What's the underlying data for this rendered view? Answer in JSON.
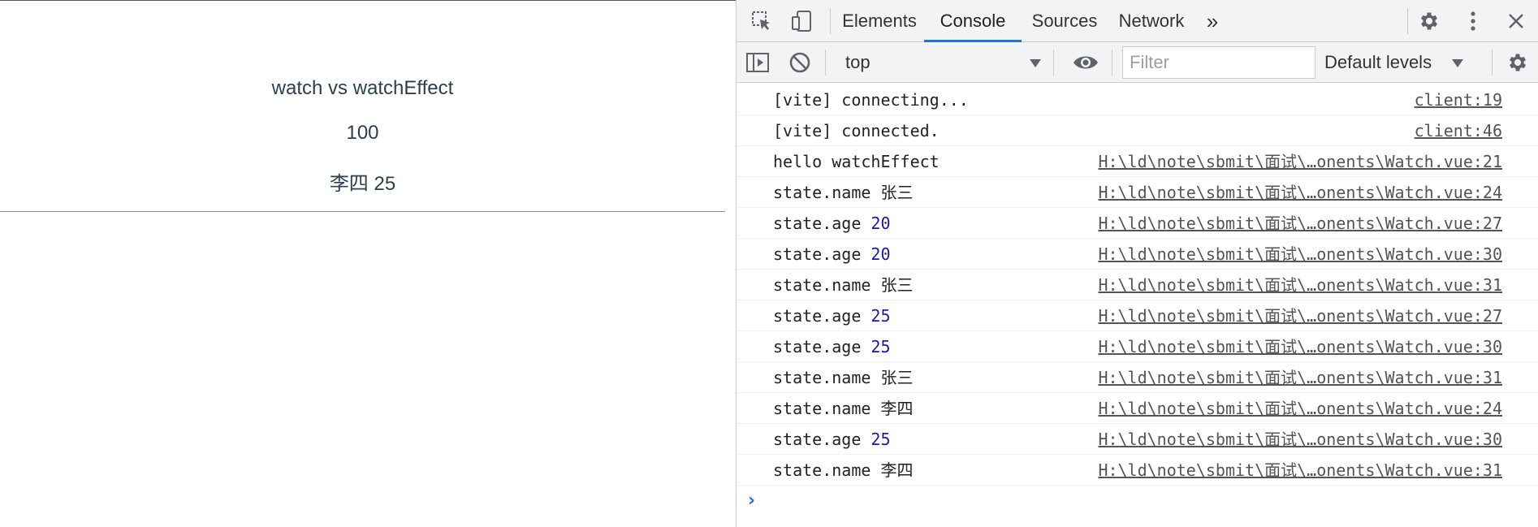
{
  "page": {
    "title": "watch vs watchEffect",
    "count": "100",
    "person": "李四 25"
  },
  "devtools": {
    "tabs": [
      {
        "label": "Elements",
        "active": false
      },
      {
        "label": "Console",
        "active": true
      },
      {
        "label": "Sources",
        "active": false
      },
      {
        "label": "Network",
        "active": false
      }
    ],
    "more_tabs_glyph": "»",
    "icons": {
      "inspect": "inspect-element-icon",
      "device": "device-toolbar-icon",
      "settings": "gear-icon",
      "menu": "kebab-menu-icon",
      "close": "close-icon",
      "sidebar": "console-sidebar-icon",
      "clear": "clear-console-icon",
      "eye": "live-expression-eye-icon",
      "console_settings": "console-settings-gear-icon"
    },
    "console_toolbar": {
      "context": "top",
      "filter_placeholder": "Filter",
      "filter_value": "",
      "levels": "Default levels"
    },
    "accent_color": "#1a73e8",
    "number_color": "#1a1aa6",
    "messages": [
      {
        "text": "[vite] connecting...",
        "label": "",
        "value": "",
        "source": "client:19"
      },
      {
        "text": "[vite] connected.",
        "label": "",
        "value": "",
        "source": "client:46"
      },
      {
        "text": "hello watchEffect",
        "label": "",
        "value": "",
        "source": "H:\\ld\\note\\sbmit\\面试\\…onents\\Watch.vue:21"
      },
      {
        "text": "",
        "label": "state.name",
        "value": "张三",
        "numeric": false,
        "source": "H:\\ld\\note\\sbmit\\面试\\…onents\\Watch.vue:24"
      },
      {
        "text": "",
        "label": "state.age",
        "value": "20",
        "numeric": true,
        "source": "H:\\ld\\note\\sbmit\\面试\\…onents\\Watch.vue:27"
      },
      {
        "text": "",
        "label": "state.age",
        "value": "20",
        "numeric": true,
        "source": "H:\\ld\\note\\sbmit\\面试\\…onents\\Watch.vue:30"
      },
      {
        "text": "",
        "label": "state.name",
        "value": "张三",
        "numeric": false,
        "source": "H:\\ld\\note\\sbmit\\面试\\…onents\\Watch.vue:31"
      },
      {
        "text": "",
        "label": "state.age",
        "value": "25",
        "numeric": true,
        "source": "H:\\ld\\note\\sbmit\\面试\\…onents\\Watch.vue:27"
      },
      {
        "text": "",
        "label": "state.age",
        "value": "25",
        "numeric": true,
        "source": "H:\\ld\\note\\sbmit\\面试\\…onents\\Watch.vue:30"
      },
      {
        "text": "",
        "label": "state.name",
        "value": "张三",
        "numeric": false,
        "source": "H:\\ld\\note\\sbmit\\面试\\…onents\\Watch.vue:31"
      },
      {
        "text": "",
        "label": "state.name",
        "value": "李四",
        "numeric": false,
        "source": "H:\\ld\\note\\sbmit\\面试\\…onents\\Watch.vue:24"
      },
      {
        "text": "",
        "label": "state.age",
        "value": "25",
        "numeric": true,
        "source": "H:\\ld\\note\\sbmit\\面试\\…onents\\Watch.vue:30"
      },
      {
        "text": "",
        "label": "state.name",
        "value": "李四",
        "numeric": false,
        "source": "H:\\ld\\note\\sbmit\\面试\\…onents\\Watch.vue:31"
      }
    ],
    "prompt_glyph": "›"
  }
}
